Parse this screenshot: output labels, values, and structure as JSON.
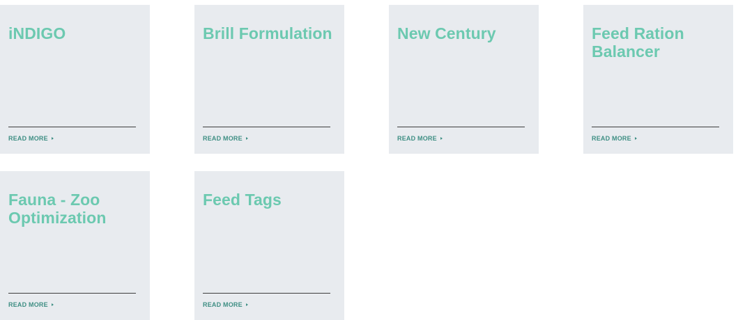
{
  "cards": [
    {
      "title": "iNDIGO",
      "link_label": "READ MORE"
    },
    {
      "title": "Brill Formulation",
      "link_label": "READ MORE"
    },
    {
      "title": "New Century",
      "link_label": "READ MORE"
    },
    {
      "title": "Feed Ration Balancer",
      "link_label": "READ MORE"
    },
    {
      "title": "Fauna - Zoo Optimization",
      "link_label": "READ MORE"
    },
    {
      "title": "Feed Tags",
      "link_label": "READ MORE"
    }
  ],
  "colors": {
    "card_background": "#e8ebef",
    "title": "#6cc9b0",
    "link": "#3f8f84",
    "rule": "#3c3c3c"
  },
  "icons": {
    "read_more_arrow": "arrow-right-icon"
  }
}
